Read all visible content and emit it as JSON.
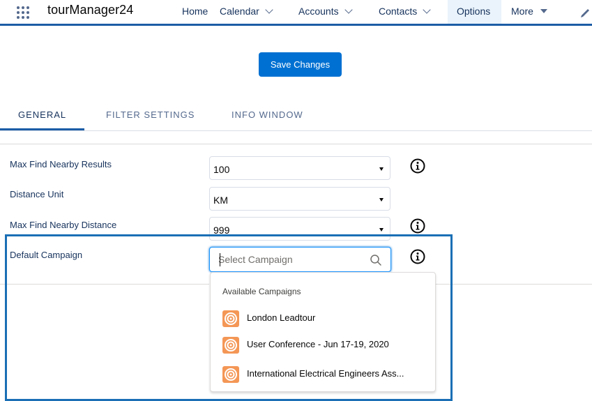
{
  "app": {
    "name": "tourManager24"
  },
  "nav": {
    "items": [
      {
        "label": "Home"
      },
      {
        "label": "Calendar"
      },
      {
        "label": "Accounts"
      },
      {
        "label": "Contacts"
      },
      {
        "label": "Options"
      },
      {
        "label": "More"
      }
    ],
    "active": "Options"
  },
  "toolbar": {
    "save_label": "Save Changes"
  },
  "tabs": [
    {
      "label": "GENERAL"
    },
    {
      "label": "FILTER SETTINGS"
    },
    {
      "label": "INFO WINDOW"
    }
  ],
  "active_tab": "GENERAL",
  "form": {
    "max_results": {
      "label": "Max Find Nearby Results",
      "value": "100"
    },
    "distance_unit": {
      "label": "Distance Unit",
      "value": "KM"
    },
    "max_distance": {
      "label": "Max Find Nearby Distance",
      "value": "999"
    },
    "default_campaign": {
      "label": "Default Campaign",
      "placeholder": "Select Campaign",
      "value": ""
    }
  },
  "dropdown": {
    "heading": "Available Campaigns",
    "items": [
      {
        "label": "London Leadtour"
      },
      {
        "label": "User Conference - Jun 17-19, 2020"
      },
      {
        "label": "International Electrical Engineers Ass..."
      }
    ]
  },
  "colors": {
    "brand": "#0070d2",
    "nav_border": "#1b5da6",
    "highlight": "#1a6fb5",
    "campaign_icon": "#f49756"
  }
}
